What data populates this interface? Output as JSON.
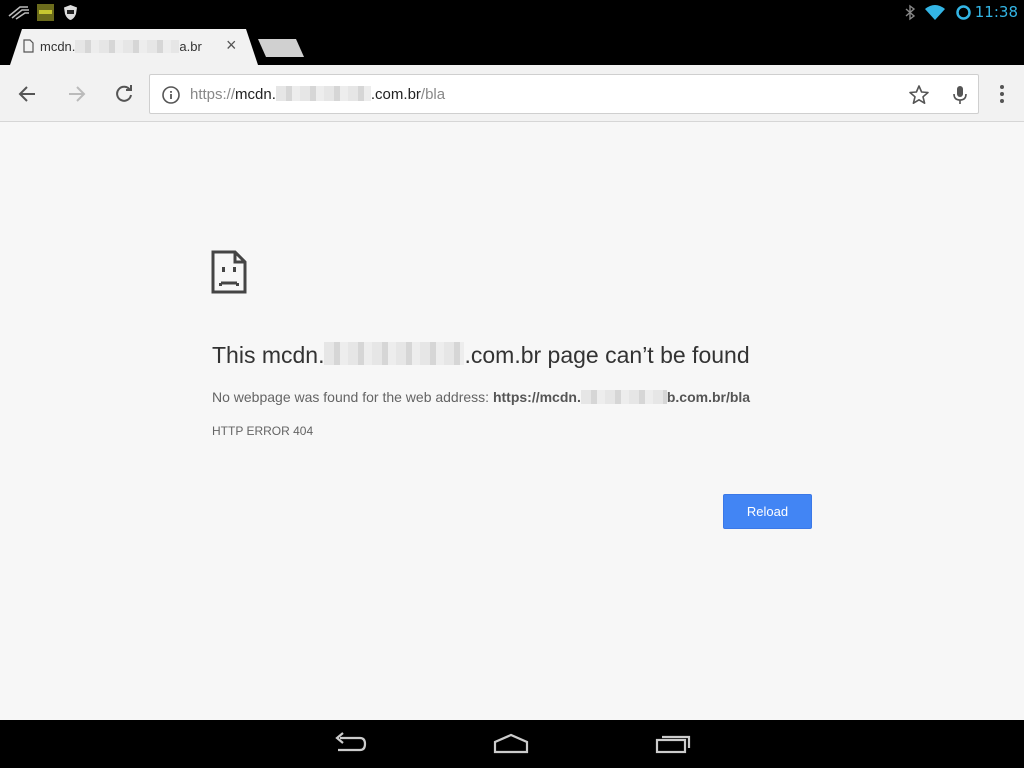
{
  "status_bar": {
    "time": "11:38",
    "left_icons": [
      "speed-notification-icon",
      "app-notification-icon",
      "shield-notification-icon"
    ],
    "right_icons": [
      "bluetooth-icon",
      "wifi-icon",
      "sync-ring-icon"
    ],
    "accent_color": "#33b5e5"
  },
  "tab": {
    "title_prefix": "mcdn.",
    "title_suffix": "a.br",
    "icon": "document-icon",
    "close_label": "×"
  },
  "toolbar": {
    "url_scheme": "https://",
    "url_host_prefix": "mcdn.",
    "url_host_suffix": ".com.br",
    "url_path": "/bla"
  },
  "error_page": {
    "heading_prefix": "This mcdn.",
    "heading_suffix": ".com.br page can’t be found",
    "desc_prefix": "No webpage was found for the web address: ",
    "desc_url_prefix": "https://mcdn.",
    "desc_url_suffix": "b.com.br/bla",
    "error_code": "HTTP ERROR 404",
    "reload_label": "Reload",
    "button_color": "#4285f4"
  },
  "nav_bar": {
    "icons": [
      "back-nav-icon",
      "home-nav-icon",
      "recents-nav-icon"
    ]
  }
}
